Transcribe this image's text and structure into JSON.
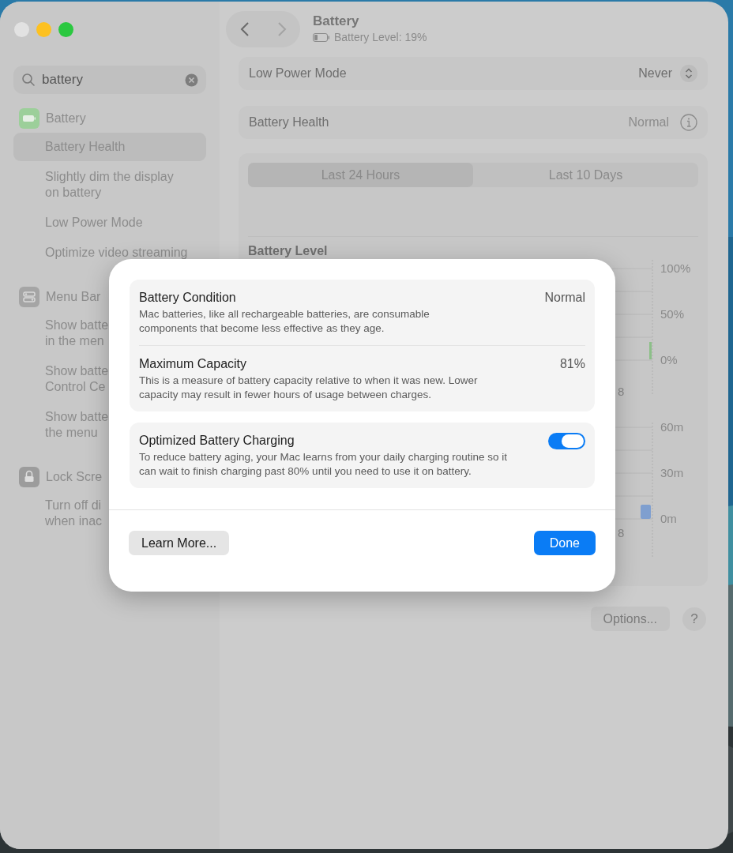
{
  "window_controls": [
    {
      "color": "#e2e2e2"
    },
    {
      "color": "#fdc121"
    },
    {
      "color": "#2bc840"
    }
  ],
  "search": {
    "value": "battery"
  },
  "sidebar": [
    {
      "label": "Battery",
      "kind": "battery",
      "children": [
        {
          "label": "Battery Health",
          "selected": true
        },
        {
          "label": "Slightly dim the display\non battery",
          "selected": false
        },
        {
          "label": "Low Power Mode",
          "selected": false
        },
        {
          "label": "Optimize video streaming",
          "selected": false
        }
      ]
    },
    {
      "label": "Menu Bar",
      "kind": "menubar",
      "children": [
        {
          "label": "Show batte\nin the men",
          "selected": false
        },
        {
          "label": "Show batte\nControl Ce",
          "selected": false
        },
        {
          "label": "Show batte\nthe menu",
          "selected": false
        }
      ]
    },
    {
      "label": "Lock Scre",
      "kind": "lock",
      "children": [
        {
          "label": "Turn off di\nwhen inac",
          "selected": false
        }
      ]
    }
  ],
  "header": {
    "title": "Battery",
    "subtitle": "Battery Level: 19%"
  },
  "settings": [
    {
      "label": "Low Power Mode",
      "value": "Never",
      "kind": "popup"
    },
    {
      "label": "Battery Health",
      "value": "Normal",
      "kind": "info"
    }
  ],
  "usage": {
    "tabs": [
      {
        "label": "Last 24 Hours",
        "selected": true
      },
      {
        "label": "Last 10 Days",
        "selected": false
      }
    ],
    "heading": "Battery Level",
    "level_axis": [
      "100%",
      "50%",
      "0%"
    ],
    "level_x_label": "8",
    "screen_axis": [
      "60m",
      "30m",
      "0m"
    ],
    "screen_x_label": "8"
  },
  "footer": {
    "options": "Options...",
    "help": "?"
  },
  "dialog": {
    "info_rows": [
      {
        "title": "Battery Condition",
        "value": "Normal",
        "description": "Mac batteries, like all rechargeable batteries, are consumable components that become less effective as they age."
      },
      {
        "title": "Maximum Capacity",
        "value": "81%",
        "description": "This is a measure of battery capacity relative to when it was new. Lower capacity may result in fewer hours of usage between charges."
      }
    ],
    "charging": {
      "title": "Optimized Battery Charging",
      "description": "To reduce battery aging, your Mac learns from your daily charging routine so it can wait to finish charging past 80% until you need to use it on battery.",
      "on": true
    },
    "buttons": {
      "secondary": "Learn More...",
      "primary": "Done"
    }
  }
}
